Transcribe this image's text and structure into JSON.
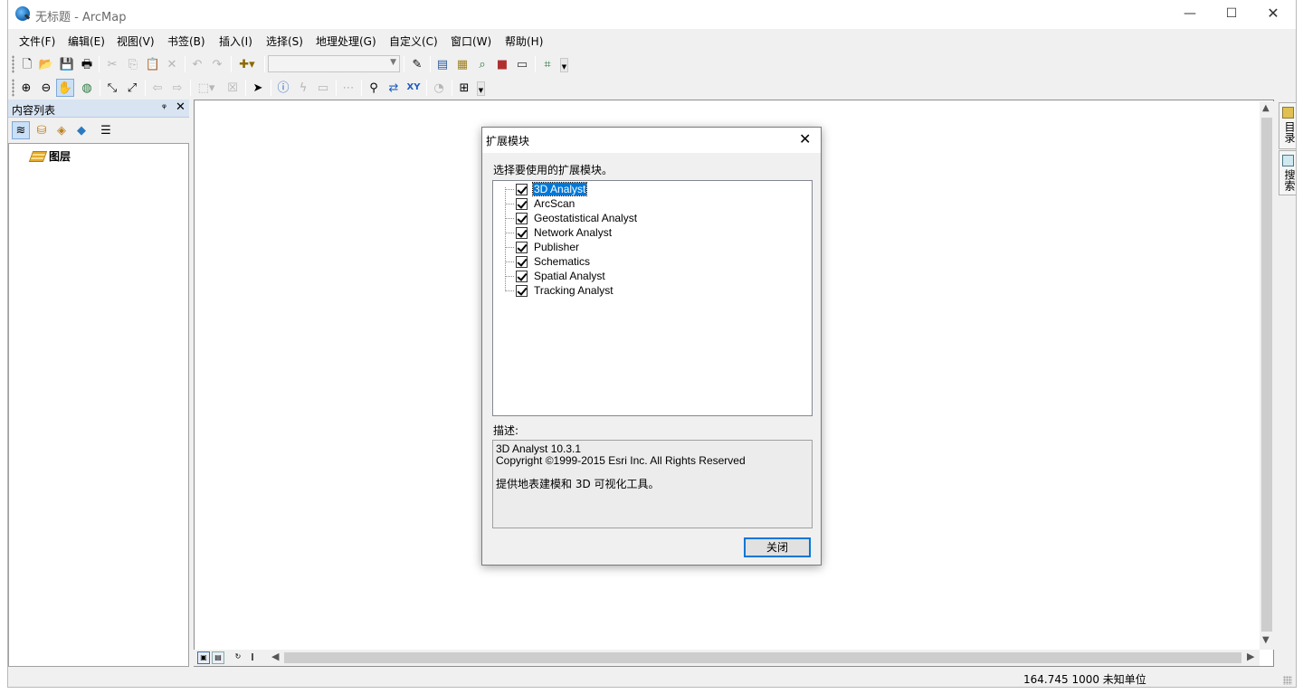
{
  "window": {
    "title": "无标题 - ArcMap",
    "controls": {
      "minimize": "—",
      "maximize": "☐",
      "close": "✕"
    }
  },
  "menu": [
    "文件(F)",
    "编辑(E)",
    "视图(V)",
    "书签(B)",
    "插入(I)",
    "选择(S)",
    "地理处理(G)",
    "自定义(C)",
    "窗口(W)",
    "帮助(H)"
  ],
  "toolbar1": {
    "icons": [
      "new-document-icon",
      "open-folder-icon",
      "save-icon",
      "print-icon",
      "cut-icon",
      "copy-icon",
      "paste-icon",
      "delete-icon",
      "undo-icon",
      "redo-icon",
      "add-data-icon",
      "editor-toolbar-icon",
      "table-of-contents-icon",
      "catalog-icon",
      "search-window-icon",
      "arctoolbox-icon",
      "python-icon",
      "model-builder-icon"
    ],
    "scale_value": ""
  },
  "toolbar2": {
    "icons": [
      "zoom-in-icon",
      "zoom-out-icon",
      "pan-icon",
      "full-extent-icon",
      "fixed-zoom-in-icon",
      "fixed-zoom-out-icon",
      "back-extent-icon",
      "forward-extent-icon",
      "select-features-icon",
      "clear-selection-icon",
      "select-elements-icon",
      "identify-icon",
      "hyperlink-icon",
      "html-popup-icon",
      "measure-icon",
      "find-icon",
      "find-route-icon",
      "go-to-xy-icon",
      "time-slider-icon",
      "create-viewer-window-icon"
    ]
  },
  "toc": {
    "title": "内容列表",
    "pin": "ᵠ",
    "close": "✕",
    "root_label": "图层"
  },
  "side_tabs": [
    "目录",
    "搜索"
  ],
  "status": {
    "coords": "164.745  1000 未知单位"
  },
  "dialog": {
    "title": "扩展模块",
    "prompt": "选择要使用的扩展模块。",
    "extensions": [
      {
        "name": "3D Analyst",
        "checked": true,
        "selected": true
      },
      {
        "name": "ArcScan",
        "checked": true,
        "selected": false
      },
      {
        "name": "Geostatistical Analyst",
        "checked": true,
        "selected": false
      },
      {
        "name": "Network Analyst",
        "checked": true,
        "selected": false
      },
      {
        "name": "Publisher",
        "checked": true,
        "selected": false
      },
      {
        "name": "Schematics",
        "checked": true,
        "selected": false
      },
      {
        "name": "Spatial Analyst",
        "checked": true,
        "selected": false
      },
      {
        "name": "Tracking Analyst",
        "checked": true,
        "selected": false
      }
    ],
    "description_label": "描述:",
    "description": {
      "line1": "3D Analyst 10.3.1",
      "line2": "Copyright ©1999-2015 Esri Inc. All Rights Reserved",
      "line3": "提供地表建模和 3D 可视化工具。"
    },
    "close_label": "关闭"
  }
}
